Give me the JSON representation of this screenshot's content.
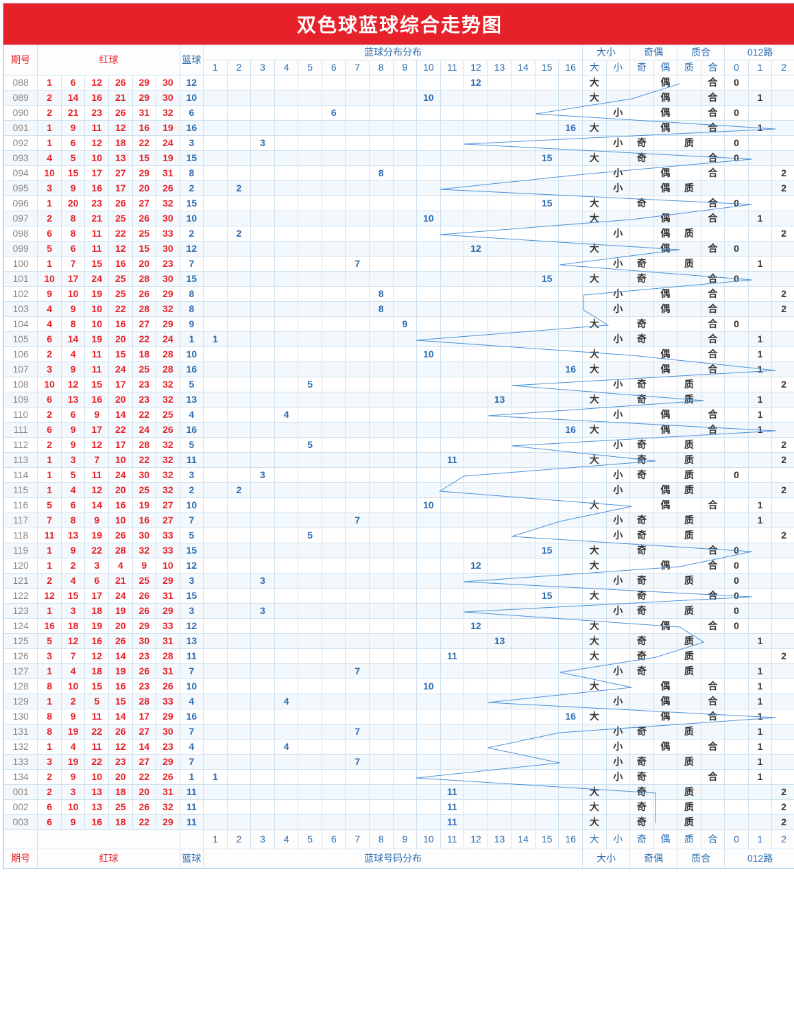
{
  "title": "双色球蓝球综合走势图",
  "headers": {
    "period": "期号",
    "red": "红球",
    "blue": "篮球",
    "dist": "蓝球分布分布",
    "dist2": "蓝球号码分布",
    "size": "大小",
    "parity": "奇偶",
    "prime": "质合",
    "route": "012路",
    "nums": [
      "1",
      "2",
      "3",
      "4",
      "5",
      "6",
      "7",
      "8",
      "9",
      "10",
      "11",
      "12",
      "13",
      "14",
      "15",
      "16"
    ],
    "sizeSub": [
      "大",
      "小"
    ],
    "paritySub": [
      "奇",
      "偶"
    ],
    "primeSub": [
      "质",
      "合"
    ],
    "routeSub": [
      "0",
      "1",
      "2"
    ]
  },
  "chart_data": {
    "type": "table",
    "title": "双色球蓝球综合走势图",
    "columns": [
      "期号",
      "红1",
      "红2",
      "红3",
      "红4",
      "红5",
      "红6",
      "篮球",
      "大小",
      "奇偶",
      "质合",
      "012路"
    ],
    "rows": [
      {
        "period": "088",
        "red": [
          1,
          6,
          12,
          26,
          29,
          30
        ],
        "blue": 12,
        "size": "大",
        "parity": "偶",
        "prime": "合",
        "route": 0
      },
      {
        "period": "089",
        "red": [
          2,
          14,
          16,
          21,
          29,
          30
        ],
        "blue": 10,
        "size": "大",
        "parity": "偶",
        "prime": "合",
        "route": 1
      },
      {
        "period": "090",
        "red": [
          2,
          21,
          23,
          26,
          31,
          32
        ],
        "blue": 6,
        "size": "小",
        "parity": "偶",
        "prime": "合",
        "route": 0
      },
      {
        "period": "091",
        "red": [
          1,
          9,
          11,
          12,
          16,
          19
        ],
        "blue": 16,
        "size": "大",
        "parity": "偶",
        "prime": "合",
        "route": 1
      },
      {
        "period": "092",
        "red": [
          1,
          6,
          12,
          18,
          22,
          24
        ],
        "blue": 3,
        "size": "小",
        "parity": "奇",
        "prime": "质",
        "route": 0
      },
      {
        "period": "093",
        "red": [
          4,
          5,
          10,
          13,
          15,
          19
        ],
        "blue": 15,
        "size": "大",
        "parity": "奇",
        "prime": "合",
        "route": 0
      },
      {
        "period": "094",
        "red": [
          10,
          15,
          17,
          27,
          29,
          31
        ],
        "blue": 8,
        "size": "小",
        "parity": "偶",
        "prime": "合",
        "route": 2
      },
      {
        "period": "095",
        "red": [
          3,
          9,
          16,
          17,
          20,
          26
        ],
        "blue": 2,
        "size": "小",
        "parity": "偶",
        "prime": "质",
        "route": 2
      },
      {
        "period": "096",
        "red": [
          1,
          20,
          23,
          26,
          27,
          32
        ],
        "blue": 15,
        "size": "大",
        "parity": "奇",
        "prime": "合",
        "route": 0
      },
      {
        "period": "097",
        "red": [
          2,
          8,
          21,
          25,
          26,
          30
        ],
        "blue": 10,
        "size": "大",
        "parity": "偶",
        "prime": "合",
        "route": 1
      },
      {
        "period": "098",
        "red": [
          6,
          8,
          11,
          22,
          25,
          33
        ],
        "blue": 2,
        "size": "小",
        "parity": "偶",
        "prime": "质",
        "route": 2
      },
      {
        "period": "099",
        "red": [
          5,
          6,
          11,
          12,
          15,
          30
        ],
        "blue": 12,
        "size": "大",
        "parity": "偶",
        "prime": "合",
        "route": 0
      },
      {
        "period": "100",
        "red": [
          1,
          7,
          15,
          16,
          20,
          23
        ],
        "blue": 7,
        "size": "小",
        "parity": "奇",
        "prime": "质",
        "route": 1
      },
      {
        "period": "101",
        "red": [
          10,
          17,
          24,
          25,
          28,
          30
        ],
        "blue": 15,
        "size": "大",
        "parity": "奇",
        "prime": "合",
        "route": 0
      },
      {
        "period": "102",
        "red": [
          9,
          10,
          19,
          25,
          26,
          29
        ],
        "blue": 8,
        "size": "小",
        "parity": "偶",
        "prime": "合",
        "route": 2
      },
      {
        "period": "103",
        "red": [
          4,
          9,
          10,
          22,
          28,
          32
        ],
        "blue": 8,
        "size": "小",
        "parity": "偶",
        "prime": "合",
        "route": 2
      },
      {
        "period": "104",
        "red": [
          4,
          8,
          10,
          16,
          27,
          29
        ],
        "blue": 9,
        "size": "大",
        "parity": "奇",
        "prime": "合",
        "route": 0
      },
      {
        "period": "105",
        "red": [
          6,
          14,
          19,
          20,
          22,
          24
        ],
        "blue": 1,
        "size": "小",
        "parity": "奇",
        "prime": "合",
        "route": 1
      },
      {
        "period": "106",
        "red": [
          2,
          4,
          11,
          15,
          18,
          28
        ],
        "blue": 10,
        "size": "大",
        "parity": "偶",
        "prime": "合",
        "route": 1
      },
      {
        "period": "107",
        "red": [
          3,
          9,
          11,
          24,
          25,
          28
        ],
        "blue": 16,
        "size": "大",
        "parity": "偶",
        "prime": "合",
        "route": 1
      },
      {
        "period": "108",
        "red": [
          10,
          12,
          15,
          17,
          23,
          32
        ],
        "blue": 5,
        "size": "小",
        "parity": "奇",
        "prime": "质",
        "route": 2
      },
      {
        "period": "109",
        "red": [
          6,
          13,
          16,
          20,
          23,
          32
        ],
        "blue": 13,
        "size": "大",
        "parity": "奇",
        "prime": "质",
        "route": 1
      },
      {
        "period": "110",
        "red": [
          2,
          6,
          9,
          14,
          22,
          25
        ],
        "blue": 4,
        "size": "小",
        "parity": "偶",
        "prime": "合",
        "route": 1
      },
      {
        "period": "111",
        "red": [
          6,
          9,
          17,
          22,
          24,
          26
        ],
        "blue": 16,
        "size": "大",
        "parity": "偶",
        "prime": "合",
        "route": 1
      },
      {
        "period": "112",
        "red": [
          2,
          9,
          12,
          17,
          28,
          32
        ],
        "blue": 5,
        "size": "小",
        "parity": "奇",
        "prime": "质",
        "route": 2
      },
      {
        "period": "113",
        "red": [
          1,
          3,
          7,
          10,
          22,
          32
        ],
        "blue": 11,
        "size": "大",
        "parity": "奇",
        "prime": "质",
        "route": 2
      },
      {
        "period": "114",
        "red": [
          1,
          5,
          11,
          24,
          30,
          32
        ],
        "blue": 3,
        "size": "小",
        "parity": "奇",
        "prime": "质",
        "route": 0
      },
      {
        "period": "115",
        "red": [
          1,
          4,
          12,
          20,
          25,
          32
        ],
        "blue": 2,
        "size": "小",
        "parity": "偶",
        "prime": "质",
        "route": 2
      },
      {
        "period": "116",
        "red": [
          5,
          6,
          14,
          16,
          19,
          27
        ],
        "blue": 10,
        "size": "大",
        "parity": "偶",
        "prime": "合",
        "route": 1
      },
      {
        "period": "117",
        "red": [
          7,
          8,
          9,
          10,
          16,
          27
        ],
        "blue": 7,
        "size": "小",
        "parity": "奇",
        "prime": "质",
        "route": 1
      },
      {
        "period": "118",
        "red": [
          11,
          13,
          19,
          26,
          30,
          33
        ],
        "blue": 5,
        "size": "小",
        "parity": "奇",
        "prime": "质",
        "route": 2
      },
      {
        "period": "119",
        "red": [
          1,
          9,
          22,
          28,
          32,
          33
        ],
        "blue": 15,
        "size": "大",
        "parity": "奇",
        "prime": "合",
        "route": 0
      },
      {
        "period": "120",
        "red": [
          1,
          2,
          3,
          4,
          9,
          10
        ],
        "blue": 12,
        "size": "大",
        "parity": "偶",
        "prime": "合",
        "route": 0
      },
      {
        "period": "121",
        "red": [
          2,
          4,
          6,
          21,
          25,
          29
        ],
        "blue": 3,
        "size": "小",
        "parity": "奇",
        "prime": "质",
        "route": 0
      },
      {
        "period": "122",
        "red": [
          12,
          15,
          17,
          24,
          26,
          31
        ],
        "blue": 15,
        "size": "大",
        "parity": "奇",
        "prime": "合",
        "route": 0
      },
      {
        "period": "123",
        "red": [
          1,
          3,
          18,
          19,
          26,
          29
        ],
        "blue": 3,
        "size": "小",
        "parity": "奇",
        "prime": "质",
        "route": 0
      },
      {
        "period": "124",
        "red": [
          16,
          18,
          19,
          20,
          29,
          33
        ],
        "blue": 12,
        "size": "大",
        "parity": "偶",
        "prime": "合",
        "route": 0
      },
      {
        "period": "125",
        "red": [
          5,
          12,
          16,
          26,
          30,
          31
        ],
        "blue": 13,
        "size": "大",
        "parity": "奇",
        "prime": "质",
        "route": 1
      },
      {
        "period": "126",
        "red": [
          3,
          7,
          12,
          14,
          23,
          28
        ],
        "blue": 11,
        "size": "大",
        "parity": "奇",
        "prime": "质",
        "route": 2
      },
      {
        "period": "127",
        "red": [
          1,
          4,
          18,
          19,
          26,
          31
        ],
        "blue": 7,
        "size": "小",
        "parity": "奇",
        "prime": "质",
        "route": 1
      },
      {
        "period": "128",
        "red": [
          8,
          10,
          15,
          16,
          23,
          26
        ],
        "blue": 10,
        "size": "大",
        "parity": "偶",
        "prime": "合",
        "route": 1
      },
      {
        "period": "129",
        "red": [
          1,
          2,
          5,
          15,
          28,
          33
        ],
        "blue": 4,
        "size": "小",
        "parity": "偶",
        "prime": "合",
        "route": 1
      },
      {
        "period": "130",
        "red": [
          8,
          9,
          11,
          14,
          17,
          29
        ],
        "blue": 16,
        "size": "大",
        "parity": "偶",
        "prime": "合",
        "route": 1
      },
      {
        "period": "131",
        "red": [
          8,
          19,
          22,
          26,
          27,
          30
        ],
        "blue": 7,
        "size": "小",
        "parity": "奇",
        "prime": "质",
        "route": 1
      },
      {
        "period": "132",
        "red": [
          1,
          4,
          11,
          12,
          14,
          23
        ],
        "blue": 4,
        "size": "小",
        "parity": "偶",
        "prime": "合",
        "route": 1
      },
      {
        "period": "133",
        "red": [
          3,
          19,
          22,
          23,
          27,
          29
        ],
        "blue": 7,
        "size": "小",
        "parity": "奇",
        "prime": "质",
        "route": 1
      },
      {
        "period": "134",
        "red": [
          2,
          9,
          10,
          20,
          22,
          26
        ],
        "blue": 1,
        "size": "小",
        "parity": "奇",
        "prime": "合",
        "route": 1
      },
      {
        "period": "001",
        "red": [
          2,
          3,
          13,
          18,
          20,
          31
        ],
        "blue": 11,
        "size": "大",
        "parity": "奇",
        "prime": "质",
        "route": 2
      },
      {
        "period": "002",
        "red": [
          6,
          10,
          13,
          25,
          26,
          32
        ],
        "blue": 11,
        "size": "大",
        "parity": "奇",
        "prime": "质",
        "route": 2
      },
      {
        "period": "003",
        "red": [
          6,
          9,
          16,
          18,
          22,
          29
        ],
        "blue": 11,
        "size": "大",
        "parity": "奇",
        "prime": "质",
        "route": 2
      }
    ]
  }
}
